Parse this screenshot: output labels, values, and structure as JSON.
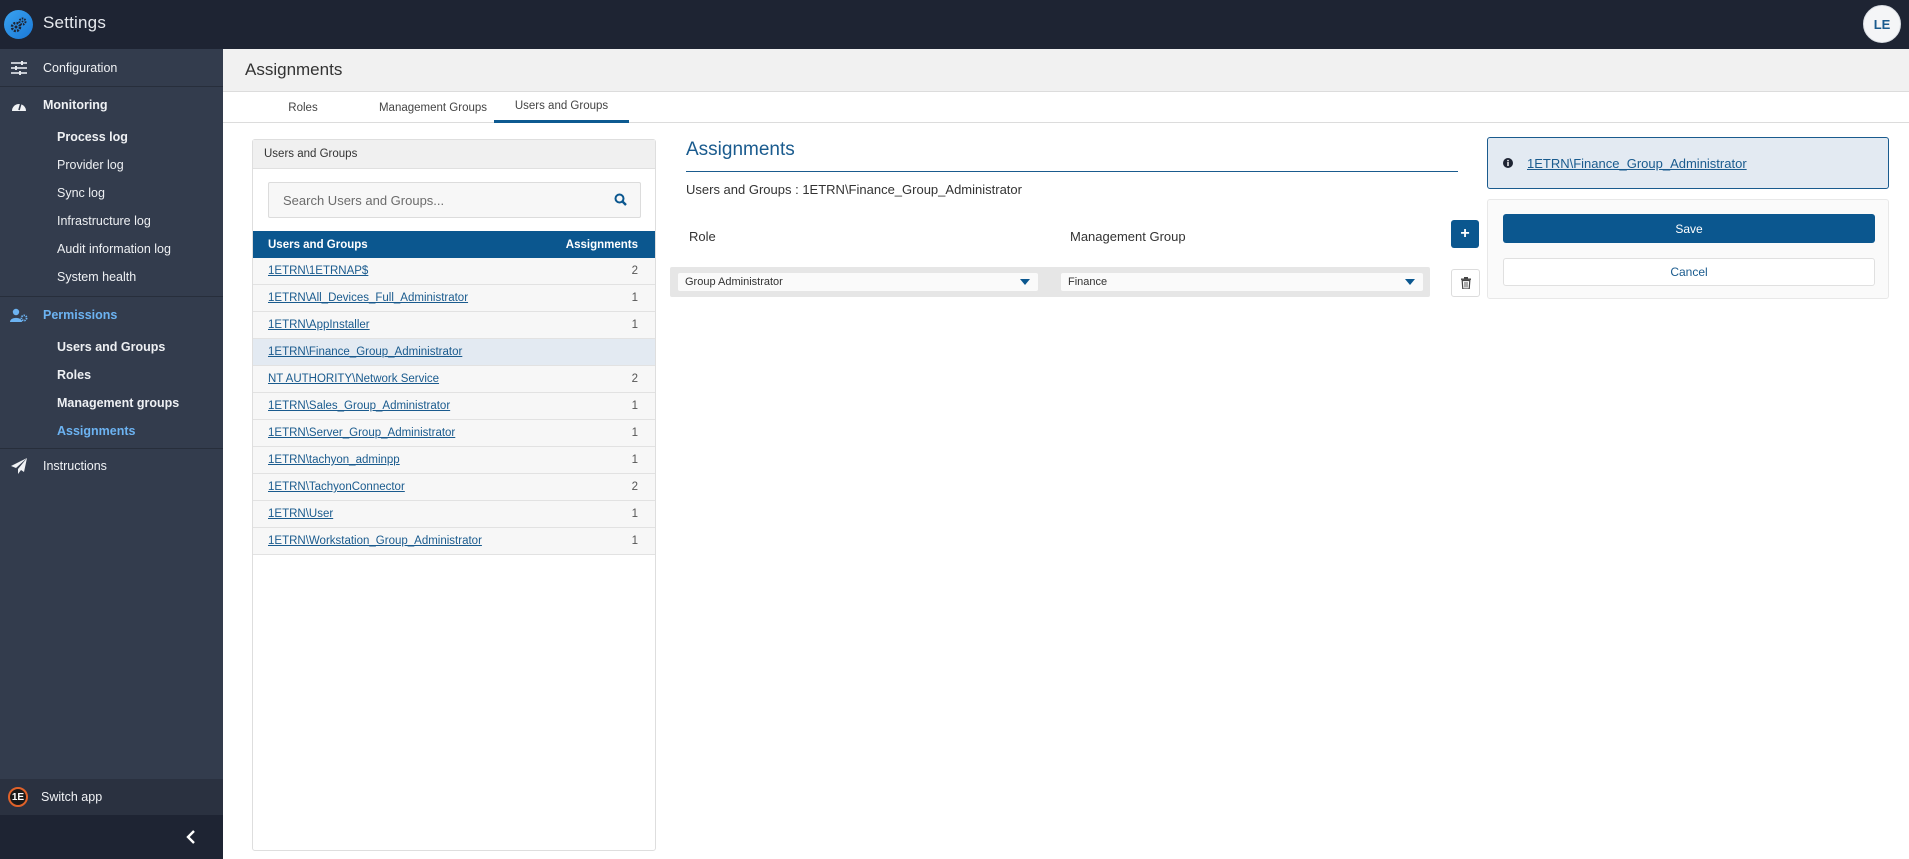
{
  "app": {
    "title": "Settings",
    "user_initials": "LE"
  },
  "sidebar": {
    "sections": [
      {
        "label": "Configuration",
        "icon": "sliders-icon"
      },
      {
        "label": "Monitoring",
        "icon": "gauge-icon",
        "items": [
          {
            "label": "Process log"
          },
          {
            "label": "Provider log"
          },
          {
            "label": "Sync log"
          },
          {
            "label": "Infrastructure log"
          },
          {
            "label": "Audit information log"
          },
          {
            "label": "System health"
          }
        ]
      },
      {
        "label": "Permissions",
        "icon": "user-gear-icon",
        "items": [
          {
            "label": "Users and Groups"
          },
          {
            "label": "Roles"
          },
          {
            "label": "Management groups"
          },
          {
            "label": "Assignments"
          }
        ]
      },
      {
        "label": "Instructions",
        "icon": "paper-plane-icon"
      }
    ],
    "switch_app": "Switch app",
    "switch_app_logo": "1E"
  },
  "page": {
    "title": "Assignments",
    "tabs": [
      {
        "label": "Roles"
      },
      {
        "label": "Management Groups"
      },
      {
        "label": "Users and Groups",
        "active": true
      }
    ]
  },
  "left_panel": {
    "header": "Users and Groups",
    "search_placeholder": "Search Users and Groups...",
    "columns": {
      "name": "Users and Groups",
      "count": "Assignments"
    },
    "rows": [
      {
        "name": "1ETRN\\1ETRNAP$",
        "count": "2"
      },
      {
        "name": "1ETRN\\All_Devices_Full_Administrator",
        "count": "1"
      },
      {
        "name": "1ETRN\\AppInstaller",
        "count": "1"
      },
      {
        "name": "1ETRN\\Finance_Group_Administrator",
        "count": "",
        "selected": true
      },
      {
        "name": "NT AUTHORITY\\Network Service",
        "count": "2"
      },
      {
        "name": "1ETRN\\Sales_Group_Administrator",
        "count": "1"
      },
      {
        "name": "1ETRN\\Server_Group_Administrator",
        "count": "1"
      },
      {
        "name": "1ETRN\\tachyon_adminpp",
        "count": "1"
      },
      {
        "name": "1ETRN\\TachyonConnector",
        "count": "2"
      },
      {
        "name": "1ETRN\\User",
        "count": "1"
      },
      {
        "name": "1ETRN\\Workstation_Group_Administrator",
        "count": "1"
      }
    ]
  },
  "content": {
    "title": "Assignments",
    "subtitle": "Users and Groups : 1ETRN\\Finance_Group_Administrator",
    "col_role": "Role",
    "col_management_group": "Management Group",
    "add_label": "+",
    "assignment": {
      "role": "Group Administrator",
      "management_group": "Finance"
    }
  },
  "info": {
    "link": "1ETRN\\Finance_Group_Administrator"
  },
  "actions": {
    "save": "Save",
    "cancel": "Cancel"
  },
  "colors": {
    "primary": "#0b578f",
    "sidebar_bg": "#333c4d",
    "topbar_bg": "#1e2433",
    "active_nav": "#6cb3f2"
  }
}
